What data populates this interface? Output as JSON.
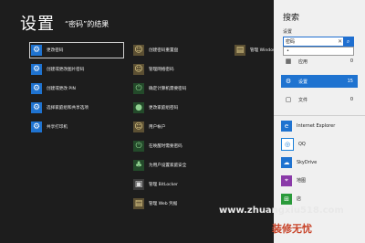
{
  "header": {
    "title": "设置",
    "subtitle": "“密码”的结果"
  },
  "results_col1": [
    {
      "label": "更改密码",
      "icon": "gear-icon"
    },
    {
      "label": "创建或更改图片密码",
      "icon": "gear-icon"
    },
    {
      "label": "创建或更改 PIN",
      "icon": "gear-icon"
    },
    {
      "label": "选择家庭组和共享选项",
      "icon": "gear-icon"
    },
    {
      "label": "共享打印机",
      "icon": "gear-icon"
    }
  ],
  "results_col2": [
    {
      "label": "创建密码重置盘",
      "icon": "user-accounts-icon"
    },
    {
      "label": "管理网络密码",
      "icon": "user-accounts-icon"
    },
    {
      "label": "确定计算机需要密码",
      "icon": "power-icon"
    },
    {
      "label": "更改家庭组密码",
      "icon": "homegroup-icon"
    },
    {
      "label": "用户帐户",
      "icon": "user-accounts-icon"
    },
    {
      "label": "在唤醒时需要密码",
      "icon": "power-icon"
    },
    {
      "label": "为用户设置家庭安全",
      "icon": "family-safety-icon"
    },
    {
      "label": "管理 BitLocker",
      "icon": "bitlocker-icon"
    },
    {
      "label": "管理 Web 凭据",
      "icon": "credential-icon"
    }
  ],
  "results_col3": [
    {
      "label": "管理 Windows",
      "icon": "credential-icon"
    }
  ],
  "pane": {
    "title": "搜索",
    "scope_label": "设置",
    "query": "密码",
    "clear_glyph": "✕",
    "go_glyph": "⌕",
    "autocomplete": "•",
    "categories": [
      {
        "label": "应用",
        "count": "0"
      },
      {
        "label": "设置",
        "count": "15"
      },
      {
        "label": "文件",
        "count": "0"
      }
    ],
    "apps": [
      {
        "label": "Internet Explorer",
        "icon": "internet-explorer-icon",
        "color": "#1f73d0"
      },
      {
        "label": "QQ",
        "icon": "qq-icon",
        "color": "#ffffff"
      },
      {
        "label": "SkyDrive",
        "icon": "skydrive-icon",
        "color": "#1f73d0"
      },
      {
        "label": "地图",
        "icon": "maps-icon",
        "color": "#8a3aa8"
      },
      {
        "label": "店",
        "icon": "store-icon",
        "color": "#2a9a3a"
      }
    ]
  },
  "watermark": {
    "url": "www.zhuangxiu518.com",
    "tagline": "装修无忧"
  },
  "colors": {
    "accent": "#1f73d0",
    "background": "#1d1d1d",
    "pane": "#f0f0f0"
  }
}
